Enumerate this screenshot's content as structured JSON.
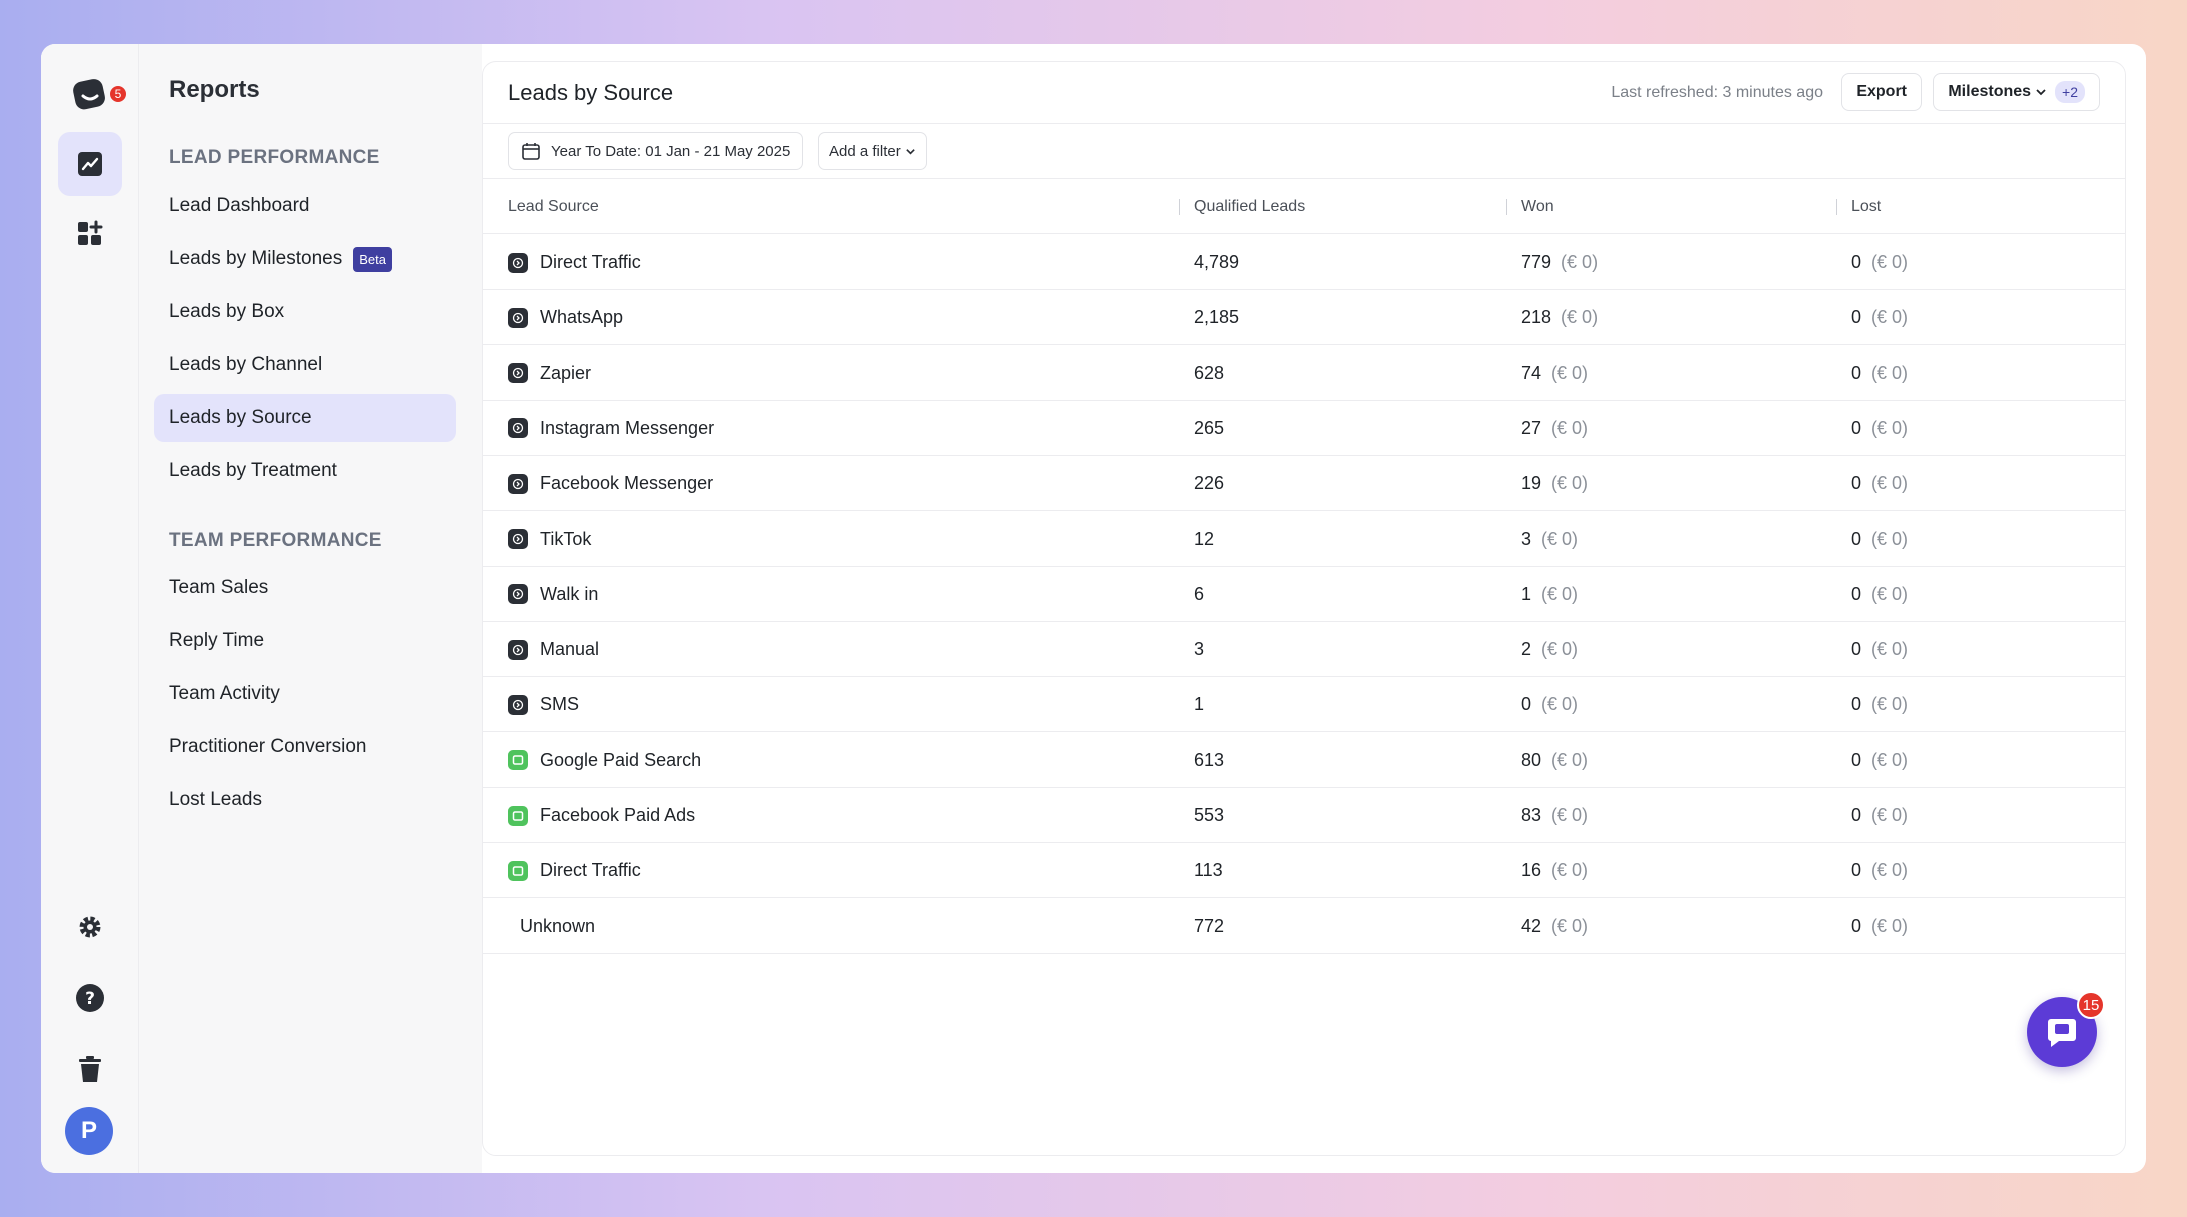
{
  "rail": {
    "logo_badge": "5",
    "avatar_initial": "P",
    "icons": [
      "logo-icon",
      "reports-icon",
      "apps-add-icon",
      "settings-icon",
      "help-icon",
      "trash-icon"
    ]
  },
  "nav": {
    "title": "Reports",
    "sections": [
      {
        "label": "LEAD PERFORMANCE",
        "items": [
          {
            "label": "Lead Dashboard"
          },
          {
            "label": "Leads by Milestones",
            "badge": "Beta"
          },
          {
            "label": "Leads by Box"
          },
          {
            "label": "Leads by Channel"
          },
          {
            "label": "Leads by Source",
            "active": true
          },
          {
            "label": "Leads by Treatment"
          }
        ]
      },
      {
        "label": "TEAM PERFORMANCE",
        "items": [
          {
            "label": "Team Sales"
          },
          {
            "label": "Reply Time"
          },
          {
            "label": "Team Activity"
          },
          {
            "label": "Practitioner Conversion"
          },
          {
            "label": "Lost Leads"
          }
        ]
      }
    ]
  },
  "main": {
    "title": "Leads by Source",
    "last_refreshed": "Last refreshed: 3 minutes ago",
    "export_label": "Export",
    "milestones_label": "Milestones",
    "milestones_extra": "+2",
    "date_filter": "Year To Date: 01 Jan - 21 May 2025",
    "add_filter": "Add a filter"
  },
  "table": {
    "columns": [
      "Lead Source",
      "Qualified Leads",
      "Won",
      "Lost"
    ],
    "rows": [
      {
        "source": "Direct Traffic",
        "icon": "dark",
        "qualified": "4,789",
        "won": "779",
        "won_value": "(€ 0)",
        "lost": "0",
        "lost_value": "(€ 0)"
      },
      {
        "source": "WhatsApp",
        "icon": "dark",
        "qualified": "2,185",
        "won": "218",
        "won_value": "(€ 0)",
        "lost": "0",
        "lost_value": "(€ 0)"
      },
      {
        "source": "Zapier",
        "icon": "dark",
        "qualified": "628",
        "won": "74",
        "won_value": "(€ 0)",
        "lost": "0",
        "lost_value": "(€ 0)"
      },
      {
        "source": "Instagram Messenger",
        "icon": "dark",
        "qualified": "265",
        "won": "27",
        "won_value": "(€ 0)",
        "lost": "0",
        "lost_value": "(€ 0)"
      },
      {
        "source": "Facebook Messenger",
        "icon": "dark",
        "qualified": "226",
        "won": "19",
        "won_value": "(€ 0)",
        "lost": "0",
        "lost_value": "(€ 0)"
      },
      {
        "source": "TikTok",
        "icon": "dark",
        "qualified": "12",
        "won": "3",
        "won_value": "(€ 0)",
        "lost": "0",
        "lost_value": "(€ 0)"
      },
      {
        "source": "Walk in",
        "icon": "dark",
        "qualified": "6",
        "won": "1",
        "won_value": "(€ 0)",
        "lost": "0",
        "lost_value": "(€ 0)"
      },
      {
        "source": "Manual",
        "icon": "dark",
        "qualified": "3",
        "won": "2",
        "won_value": "(€ 0)",
        "lost": "0",
        "lost_value": "(€ 0)"
      },
      {
        "source": "SMS",
        "icon": "dark",
        "qualified": "1",
        "won": "0",
        "won_value": "(€ 0)",
        "lost": "0",
        "lost_value": "(€ 0)"
      },
      {
        "source": "Google Paid Search",
        "icon": "green",
        "qualified": "613",
        "won": "80",
        "won_value": "(€ 0)",
        "lost": "0",
        "lost_value": "(€ 0)"
      },
      {
        "source": "Facebook Paid Ads",
        "icon": "green",
        "qualified": "553",
        "won": "83",
        "won_value": "(€ 0)",
        "lost": "0",
        "lost_value": "(€ 0)"
      },
      {
        "source": "Direct Traffic",
        "icon": "green",
        "qualified": "113",
        "won": "16",
        "won_value": "(€ 0)",
        "lost": "0",
        "lost_value": "(€ 0)"
      },
      {
        "source": "Unknown",
        "icon": "none",
        "qualified": "772",
        "won": "42",
        "won_value": "(€ 0)",
        "lost": "0",
        "lost_value": "(€ 0)"
      }
    ]
  },
  "chat": {
    "badge": "15"
  },
  "colors": {
    "accent": "#3f3fa0",
    "active_bg": "#e3e3fb",
    "chat": "#5c3bd6",
    "badge": "#e5352b",
    "paid_icon": "#4fc35d"
  }
}
